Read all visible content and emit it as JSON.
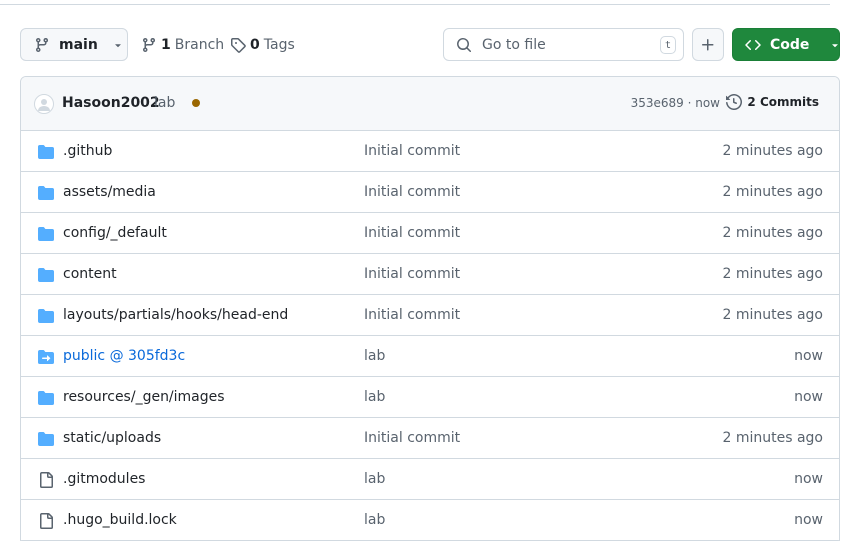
{
  "toolbar": {
    "branch_label": "main",
    "branches_count": "1",
    "branches_label": "Branch",
    "tags_count": "0",
    "tags_label": "Tags",
    "search_placeholder": "Go to file",
    "search_shortcut": "t",
    "code_label": "Code"
  },
  "latest_commit": {
    "author": "Hasoon2002",
    "message": "lab",
    "status_color": "#9a6700",
    "sha_time": "353e689 · now",
    "commits_label": "2 Commits"
  },
  "files": [
    {
      "name": ".github",
      "type": "folder",
      "message": "Initial commit",
      "time": "2 minutes ago"
    },
    {
      "name": "assets/media",
      "type": "folder",
      "message": "Initial commit",
      "time": "2 minutes ago"
    },
    {
      "name": "config/_default",
      "type": "folder",
      "message": "Initial commit",
      "time": "2 minutes ago"
    },
    {
      "name": "content",
      "type": "folder",
      "message": "Initial commit",
      "time": "2 minutes ago"
    },
    {
      "name": "layouts/partials/hooks/head-end",
      "type": "folder",
      "message": "Initial commit",
      "time": "2 minutes ago"
    },
    {
      "name": "public @ 305fd3c",
      "type": "submodule",
      "message": "lab",
      "time": "now"
    },
    {
      "name": "resources/_gen/images",
      "type": "folder",
      "message": "lab",
      "time": "now"
    },
    {
      "name": "static/uploads",
      "type": "folder",
      "message": "Initial commit",
      "time": "2 minutes ago"
    },
    {
      "name": ".gitmodules",
      "type": "file",
      "message": "lab",
      "time": "now"
    },
    {
      "name": ".hugo_build.lock",
      "type": "file",
      "message": "lab",
      "time": "now"
    }
  ],
  "colors": {
    "folder": "#54aeff",
    "link": "#0969da",
    "primary_button": "#1f883d"
  }
}
